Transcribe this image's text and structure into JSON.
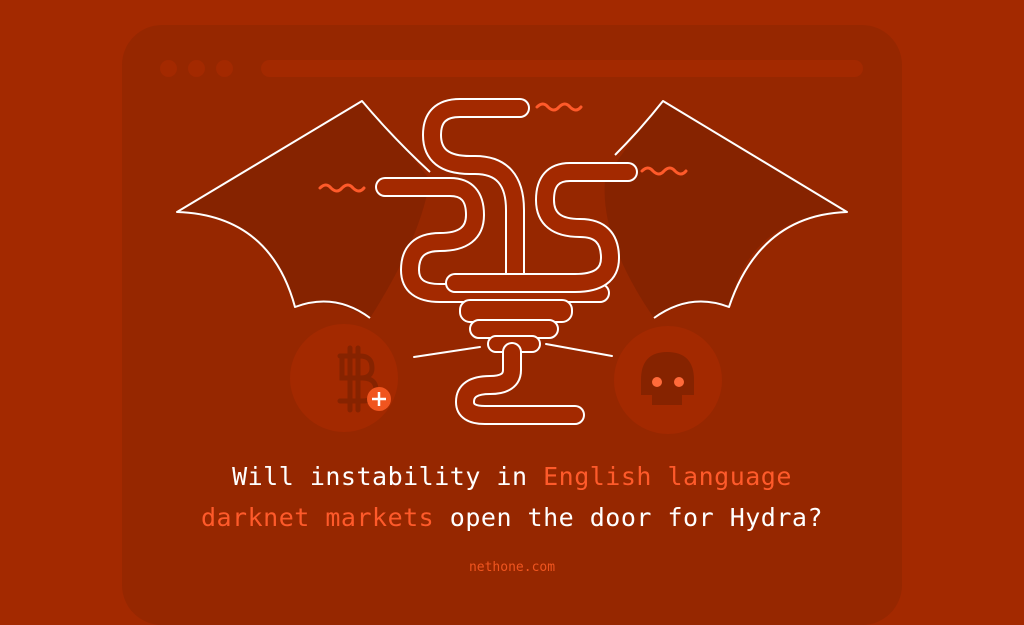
{
  "browser": {
    "window_dots": [
      "dot-1",
      "dot-2",
      "dot-3"
    ],
    "address_bar": ""
  },
  "illustration": {
    "subject": "winged hydra serpent",
    "left_badge_icon": "bitcoin-plus-icon",
    "right_badge_icon": "skull-icon"
  },
  "headline": {
    "line1_a": "Will instability in ",
    "line1_b": "English language",
    "line2_a": "darknet markets",
    "line2_b": " open the door for Hydra?"
  },
  "footer": {
    "site": "nethone.com"
  },
  "colors": {
    "background": "#a32900",
    "window": "#962700",
    "wing": "#862300",
    "highlight": "#ff5a2a",
    "line": "#ffffff"
  }
}
